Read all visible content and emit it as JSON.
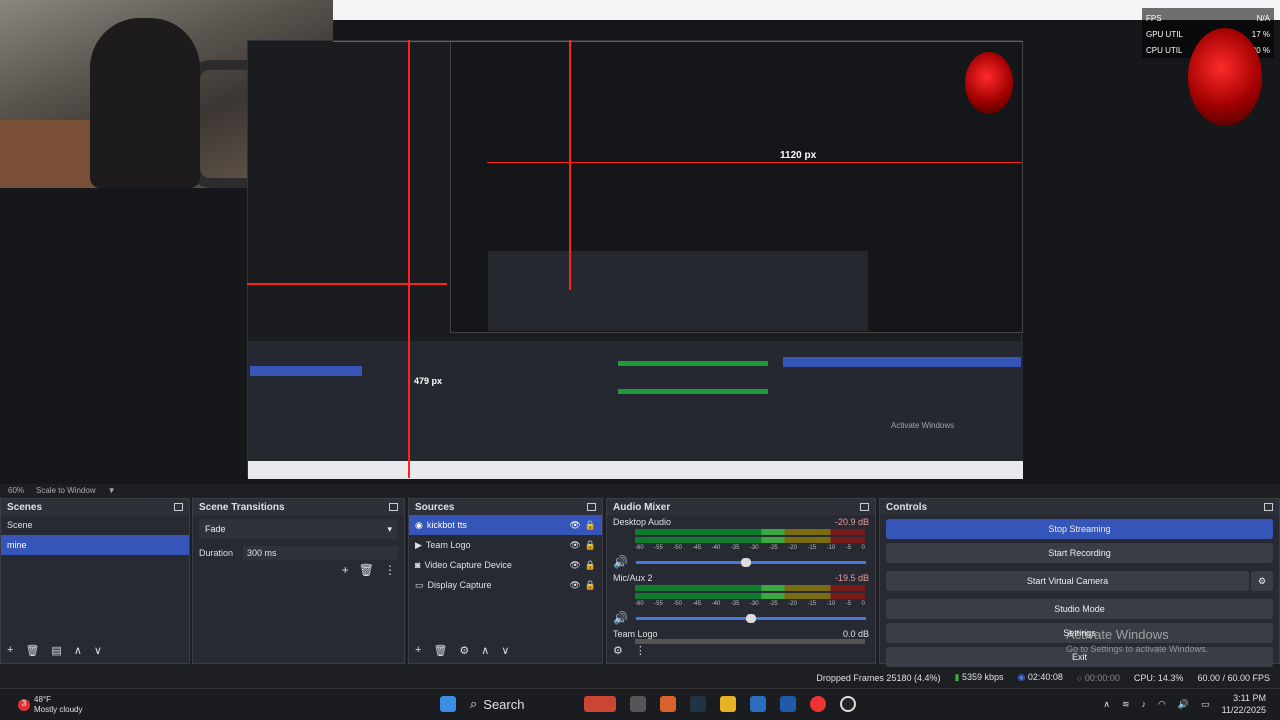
{
  "overlay": {
    "fps_label": "FPS",
    "fps_value": "N/A",
    "gpu_label": "GPU UTIL",
    "gpu_value": "17 %",
    "cpu_label": "CPU UTIL",
    "cpu_value": "30 %",
    "measure_1120": "1120 px",
    "measure_479": "479 px",
    "nested_activate": "Activate Windows"
  },
  "preview_bar": {
    "zoom": "60%",
    "scale": "Scale to Window"
  },
  "scenes": {
    "title": "Scenes",
    "items": [
      "Scene",
      "mine"
    ],
    "selected": "mine"
  },
  "transitions": {
    "title": "Scene Transitions",
    "fade": "Fade",
    "duration_label": "Duration",
    "duration_value": "300 ms"
  },
  "sources": {
    "title": "Sources",
    "items": [
      {
        "label": "kickbot tts",
        "icon": "globe-icon"
      },
      {
        "label": "Team Logo",
        "icon": "play-icon"
      },
      {
        "label": "Video Capture Device",
        "icon": "camera-icon"
      },
      {
        "label": "Display Capture",
        "icon": "monitor-icon"
      }
    ]
  },
  "audio": {
    "title": "Audio Mixer",
    "tracks": [
      {
        "name": "Desktop Audio",
        "db": "-20.9 dB",
        "vol": 0.47
      },
      {
        "name": "Mic/Aux 2",
        "db": "-19.5 dB",
        "vol": 0.5
      },
      {
        "name": "Team Logo",
        "db": "0.0 dB",
        "vol": 0.0
      }
    ],
    "ticks": [
      "-60",
      "-55",
      "-50",
      "-45",
      "-40",
      "-35",
      "-30",
      "-25",
      "-20",
      "-15",
      "-10",
      "-5",
      "0"
    ]
  },
  "controls": {
    "title": "Controls",
    "stop_streaming": "Stop Streaming",
    "start_recording": "Start Recording",
    "start_virtual_camera": "Start Virtual Camera",
    "studio_mode": "Studio Mode",
    "settings": "Settings",
    "exit": "Exit",
    "activate_windows": "Activate Windows",
    "activate_sub": "Go to Settings to activate Windows."
  },
  "status": {
    "dropped": "Dropped Frames 25180 (4.4%)",
    "kbps": "5359 kbps",
    "stream_time": "02:40:08",
    "rec_time": "00:00:00",
    "cpu": "CPU: 14.3%",
    "fps": "60.00 / 60.00 FPS"
  },
  "taskbar": {
    "temp": "48°F",
    "weather": "Mostly cloudy",
    "badge": "3",
    "search": "Search",
    "time": "3:11 PM",
    "date": "11/22/2025"
  }
}
